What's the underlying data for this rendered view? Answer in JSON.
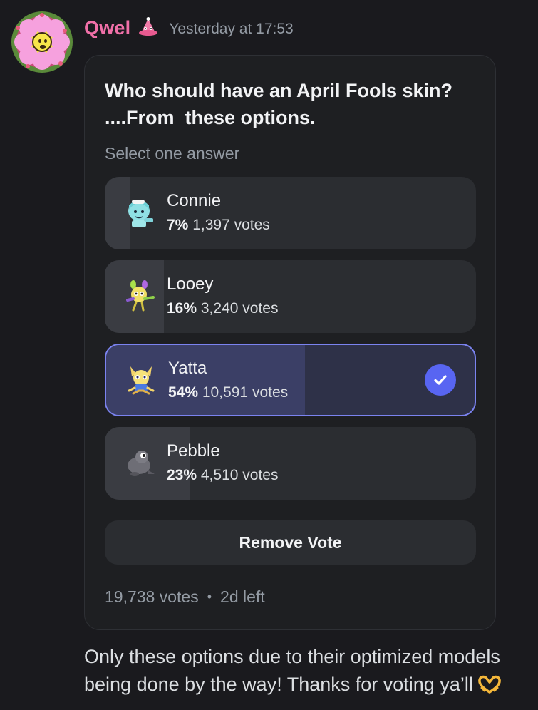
{
  "message": {
    "author": "Qwel",
    "author_color": "#f070a8",
    "timestamp": "Yesterday at 17:53",
    "avatar_icon": "flower-avatar",
    "role_icon": "pink-cone-badge-icon",
    "text": "Only these options due to their optimized models being done by the way! Thanks for voting ya’ll",
    "trailing_emoji": "heart-hands-emoji"
  },
  "poll": {
    "question_line1": "Who should have an April Fools skin?",
    "question_line2": "....From  these options.",
    "hint": "Select one answer",
    "options": [
      {
        "name": "Connie",
        "percent": "7%",
        "votes": "1,397 votes",
        "fraction": 0.07,
        "emoji": "connie-emoji",
        "selected": false
      },
      {
        "name": "Looey",
        "percent": "16%",
        "votes": "3,240 votes",
        "fraction": 0.16,
        "emoji": "looey-emoji",
        "selected": false
      },
      {
        "name": "Yatta",
        "percent": "54%",
        "votes": "10,591 votes",
        "fraction": 0.54,
        "emoji": "yatta-emoji",
        "selected": true
      },
      {
        "name": "Pebble",
        "percent": "23%",
        "votes": "4,510 votes",
        "fraction": 0.23,
        "emoji": "pebble-emoji",
        "selected": false
      }
    ],
    "remove_vote_label": "Remove Vote",
    "total_votes": "19,738 votes",
    "separator": "•",
    "time_left": "2d left",
    "accent_color": "#5865f2"
  }
}
